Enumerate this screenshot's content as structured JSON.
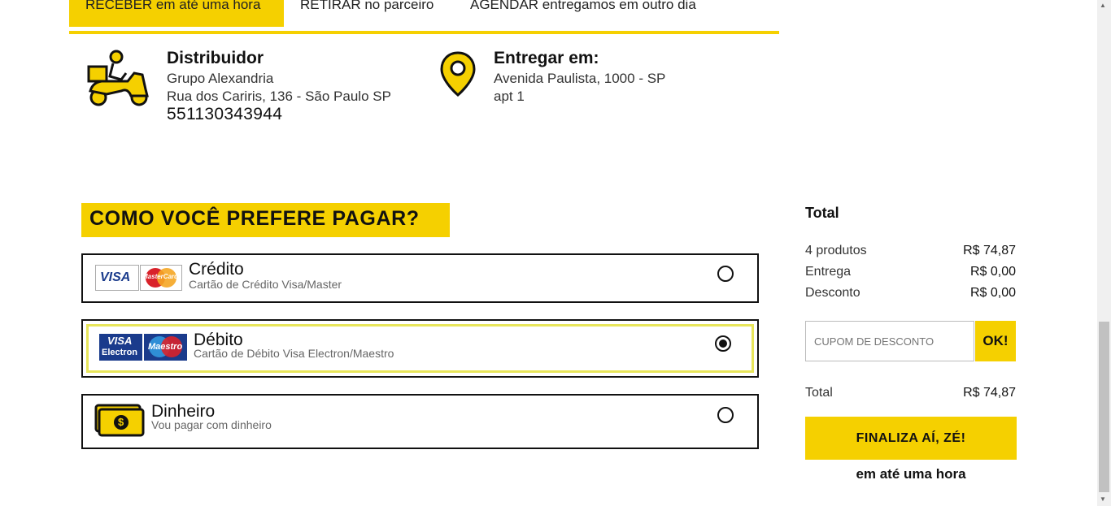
{
  "tabs": [
    {
      "label": "RECEBER em até uma hora",
      "active": true
    },
    {
      "label": "RETIRAR no parceiro",
      "active": false
    },
    {
      "label": "AGENDAR entregamos em outro dia",
      "active": false
    }
  ],
  "distributor": {
    "title": "Distribuidor",
    "name": "Grupo Alexandria",
    "address": "Rua dos Cariris, 136 - São Paulo SP",
    "phone": "551130343944"
  },
  "delivery": {
    "title": "Entregar em:",
    "line1": "Avenida Paulista, 1000 - SP",
    "line2": "apt 1"
  },
  "payment": {
    "title": "COMO VOCÊ PREFERE PAGAR?",
    "options": [
      {
        "name": "Crédito",
        "sub": "Cartão de Crédito Visa/Master",
        "selected": false
      },
      {
        "name": "Débito",
        "sub": "Cartão de Débito Visa Electron/Maestro",
        "selected": true
      },
      {
        "name": "Dinheiro",
        "sub": "Vou pagar com dinheiro",
        "selected": false
      }
    ],
    "logos": {
      "visa": "VISA",
      "mastercard": "MasterCard",
      "visa_electron_1": "VISA",
      "visa_electron_2": "Electron",
      "maestro": "Maestro",
      "cash_symbol": "$"
    }
  },
  "summary": {
    "title": "Total",
    "rows": [
      {
        "label": "4 produtos",
        "value": "R$ 74,87"
      },
      {
        "label": "Entrega",
        "value": "R$ 0,00"
      },
      {
        "label": "Desconto",
        "value": "R$ 0,00"
      }
    ],
    "coupon_placeholder": "CUPOM DE DESCONTO",
    "coupon_button": "OK!",
    "total_label": "Total",
    "total_value": "R$ 74,87",
    "finalize_button": "FINALIZA AÍ, ZÉ!",
    "delivery_note": "em até uma hora"
  },
  "colors": {
    "accent": "#f5d000",
    "selected_border": "#e8e65a"
  }
}
